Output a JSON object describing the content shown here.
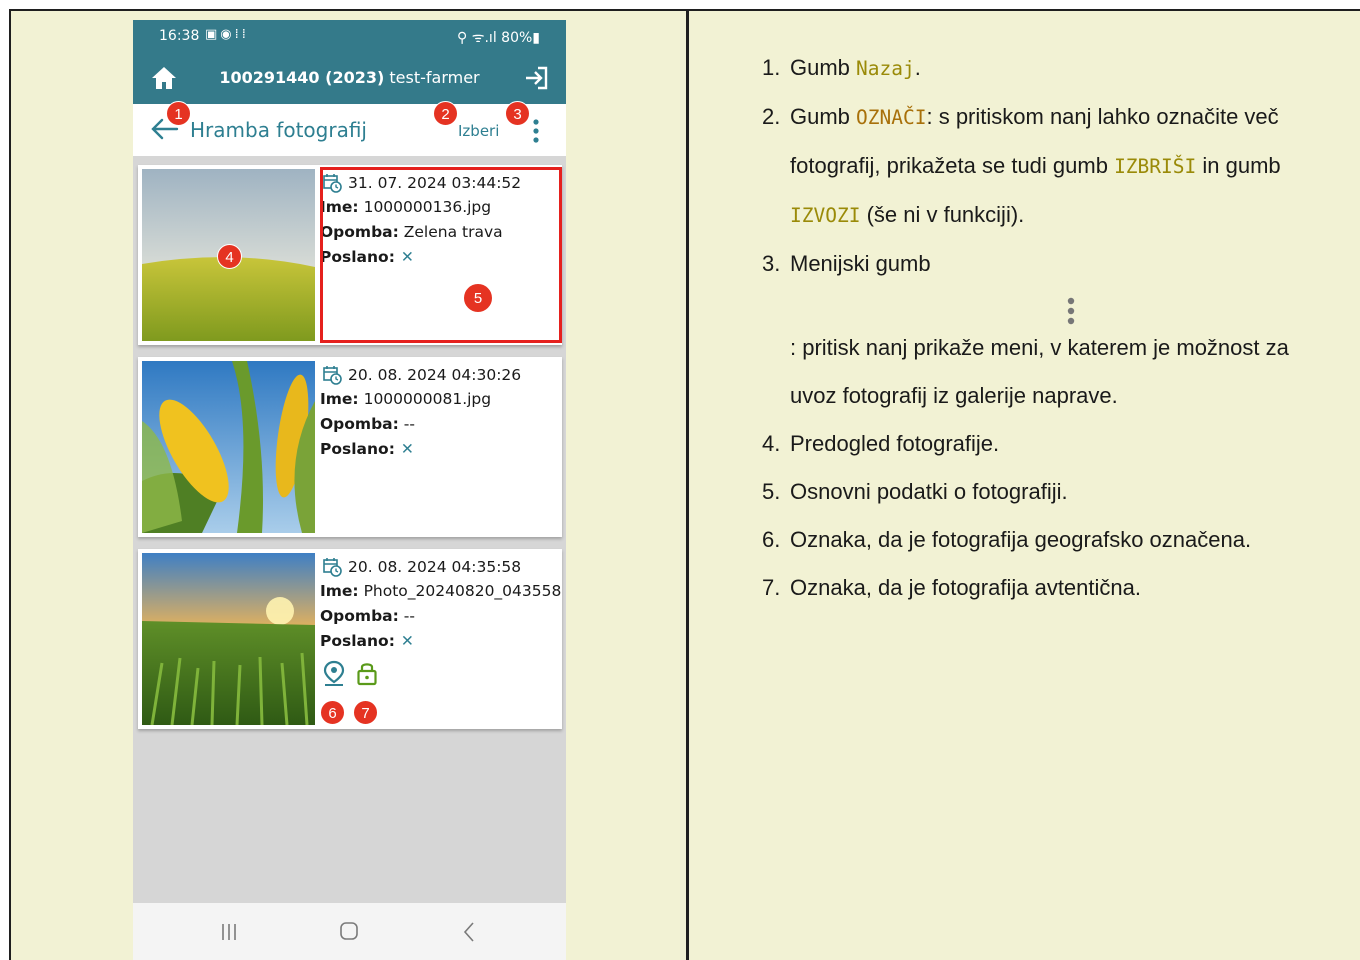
{
  "status_bar": {
    "time": "16:38",
    "indicator_icons": [
      "gallery-icon",
      "sync-icon",
      "grid-dots-icon"
    ],
    "right": "⚲ ᯤ.ıl 80%▮",
    "battery": "80%"
  },
  "app_bar": {
    "id": "100291440 (2023)",
    "user": "test-farmer"
  },
  "toolbar": {
    "title": "Hramba fotografij",
    "select_label": "Izberi"
  },
  "photos": [
    {
      "date": "31. 07. 2024 03:44:52",
      "name_label": "Ime:",
      "name": "1000000136.jpg",
      "note_label": "Opomba:",
      "note": "Zelena trava",
      "sent_label": "Poslano:",
      "sent": false,
      "geotagged": false,
      "authentic": false
    },
    {
      "date": "20. 08. 2024 04:30:26",
      "name_label": "Ime:",
      "name": "1000000081.jpg",
      "note_label": "Opomba:",
      "note": "--",
      "sent_label": "Poslano:",
      "sent": false,
      "geotagged": false,
      "authentic": false
    },
    {
      "date": "20. 08. 2024 04:35:58",
      "name_label": "Ime:",
      "name": "Photo_20240820_043558",
      "note_label": "Opomba:",
      "note": "--",
      "sent_label": "Poslano:",
      "sent": false,
      "geotagged": true,
      "authentic": true
    }
  ],
  "callouts": [
    "1",
    "2",
    "3",
    "4",
    "5",
    "6",
    "7"
  ],
  "colors": {
    "teal": "#347a8a",
    "badge_red": "#e53322",
    "highlight_red": "#e5201d",
    "page_bg": "#f2f2d4",
    "lock_green": "#5a9a1a"
  },
  "legend": {
    "item1": {
      "num": "1.",
      "pre": "Gumb ",
      "code": "Nazaj",
      "post": "."
    },
    "item2": {
      "num": "2.",
      "pre": "Gumb ",
      "code1": "OZNAČI",
      "mid1": ": s pritiskom nanj lahko označite več",
      "line2": "fotografij, prikažeta se tudi gumb ",
      "code2": "IZBRIŠI",
      "mid2": " in gumb",
      "code3": "IZVOZI",
      "post": " (še ni v funkciji)."
    },
    "item3": {
      "num": "3.",
      "text": "Menijski gumb",
      "line2": ": pritisk nanj prikaže meni, v katerem je možnost za",
      "line3": "uvoz fotografij iz galerije naprave."
    },
    "item4": {
      "num": "4.",
      "text": "Predogled fotografije."
    },
    "item5": {
      "num": "5.",
      "text": "Osnovni podatki o fotografiji."
    },
    "item6": {
      "num": "6.",
      "text": "Oznaka, da je fotografija geografsko označena."
    },
    "item7": {
      "num": "7.",
      "text": "Oznaka, da je fotografija avtentična."
    }
  }
}
